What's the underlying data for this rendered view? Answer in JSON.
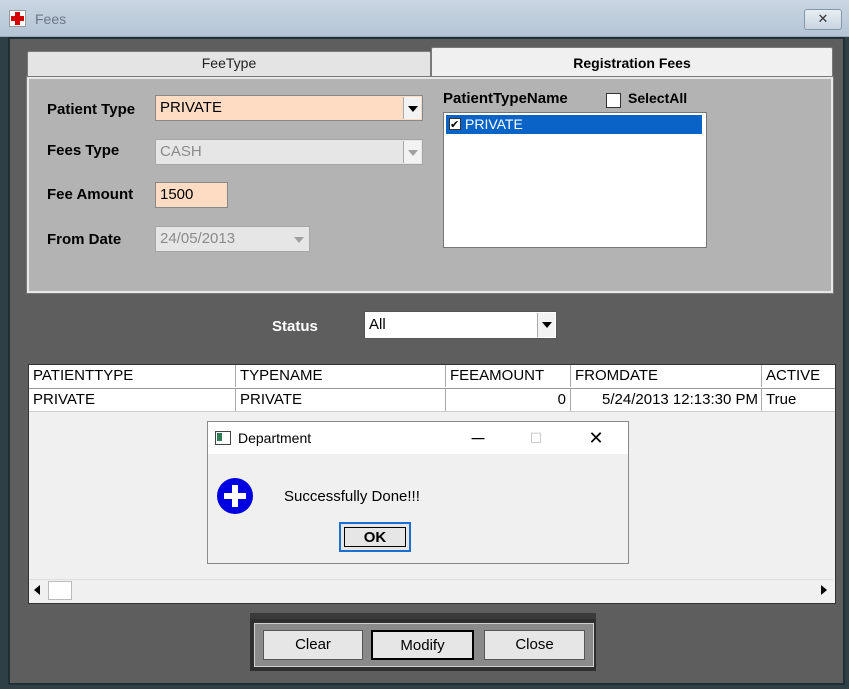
{
  "window": {
    "title": "Fees",
    "close_glyph": "✕"
  },
  "tabs": [
    {
      "label": "FeeType"
    },
    {
      "label": "Registration Fees"
    }
  ],
  "form": {
    "patient_type": {
      "label": "Patient Type",
      "value": "PRIVATE"
    },
    "fees_type": {
      "label": "Fees Type",
      "value": "CASH"
    },
    "fee_amount": {
      "label": "Fee Amount",
      "value": "1500"
    },
    "from_date": {
      "label": "From Date",
      "value": "24/05/2013"
    }
  },
  "patient_type_list": {
    "header": "PatientTypeName",
    "select_all_label": "SelectAll",
    "items": [
      {
        "label": "PRIVATE",
        "checked": true
      }
    ]
  },
  "status": {
    "label": "Status",
    "value": "All"
  },
  "grid": {
    "columns": [
      "PATIENTTYPE",
      "TYPENAME",
      "FEEAMOUNT",
      "FROMDATE",
      "ACTIVE"
    ],
    "rows": [
      [
        "PRIVATE",
        "PRIVATE",
        "0",
        "5/24/2013 12:13:30 PM",
        "True"
      ]
    ]
  },
  "buttons": {
    "clear": "Clear",
    "modify": "Modify",
    "close": "Close"
  },
  "dialog": {
    "title": "Department",
    "message": "Successfully Done!!!",
    "ok_label": "OK",
    "minimize_glyph": "─",
    "maximize_glyph": "☐",
    "close_glyph": "✕"
  },
  "colors": {
    "input_highlight": "#fddcc3",
    "selection": "#0a64c8",
    "info_icon": "#0000e0"
  }
}
